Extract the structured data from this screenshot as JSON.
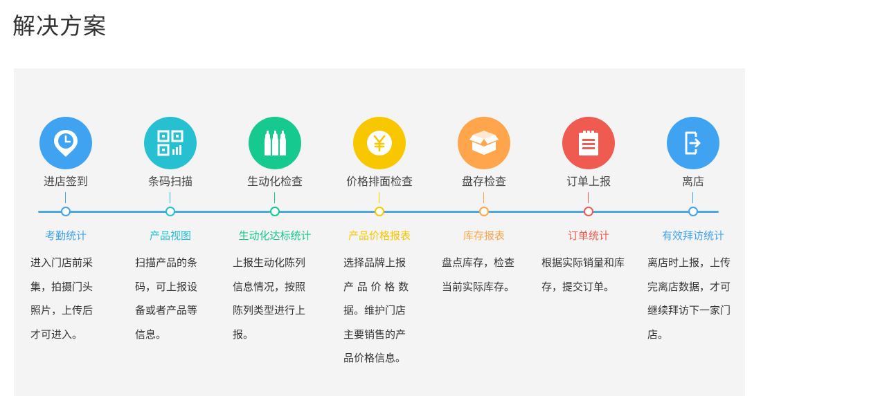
{
  "page_title": "解决方案",
  "timeline_color": "#4ea8e0",
  "steps": [
    {
      "label": "进店签到",
      "icon": "location-clock-icon",
      "color": "#3fa3f2",
      "stat_title": "考勤统计",
      "stat_color": "#3fa3f2",
      "description": "进入门店前采\n集，拍摄门头\n照片，上传后\n才可进入。"
    },
    {
      "label": "条码扫描",
      "icon": "qr-code-icon",
      "color": "#27c0d1",
      "stat_title": "产品视图",
      "stat_color": "#27c0d1",
      "description": "扫描产品的条\n码，可上报设\n备或者产品等\n信息。"
    },
    {
      "label": "生动化检查",
      "icon": "bottles-icon",
      "color": "#15c98f",
      "stat_title": "生动化达标统计",
      "stat_color": "#15c98f",
      "description": "上报生动化陈列\n信息情况，按照\n陈列类型进行上\n报。"
    },
    {
      "label": "价格排面检查",
      "icon": "yen-coin-icon",
      "color": "#f9c700",
      "stat_title": "产品价格报表",
      "stat_color": "#f9c700",
      "description": "选择品牌上报\n产 品 价 格 数\n据。维护门店\n主要销售的产\n品价格信息。"
    },
    {
      "label": "盘存检查",
      "icon": "open-box-icon",
      "color": "#ffa64d",
      "stat_title": "库存报表",
      "stat_color": "#ffa64d",
      "description": "盘点库存，检查\n当前实际库存。"
    },
    {
      "label": "订单上报",
      "icon": "clipboard-list-icon",
      "color": "#ef5b50",
      "stat_title": "订单统计",
      "stat_color": "#ef5b50",
      "description": "根据实际销量和库\n存，提交订单。"
    },
    {
      "label": "离店",
      "icon": "exit-door-icon",
      "color": "#3fa3f2",
      "stat_title": "有效拜访统计",
      "stat_color": "#3fa3f2",
      "description": "离店时上报，上传\n完离店数据，才可\n继续拜访下一家门\n店。"
    }
  ]
}
